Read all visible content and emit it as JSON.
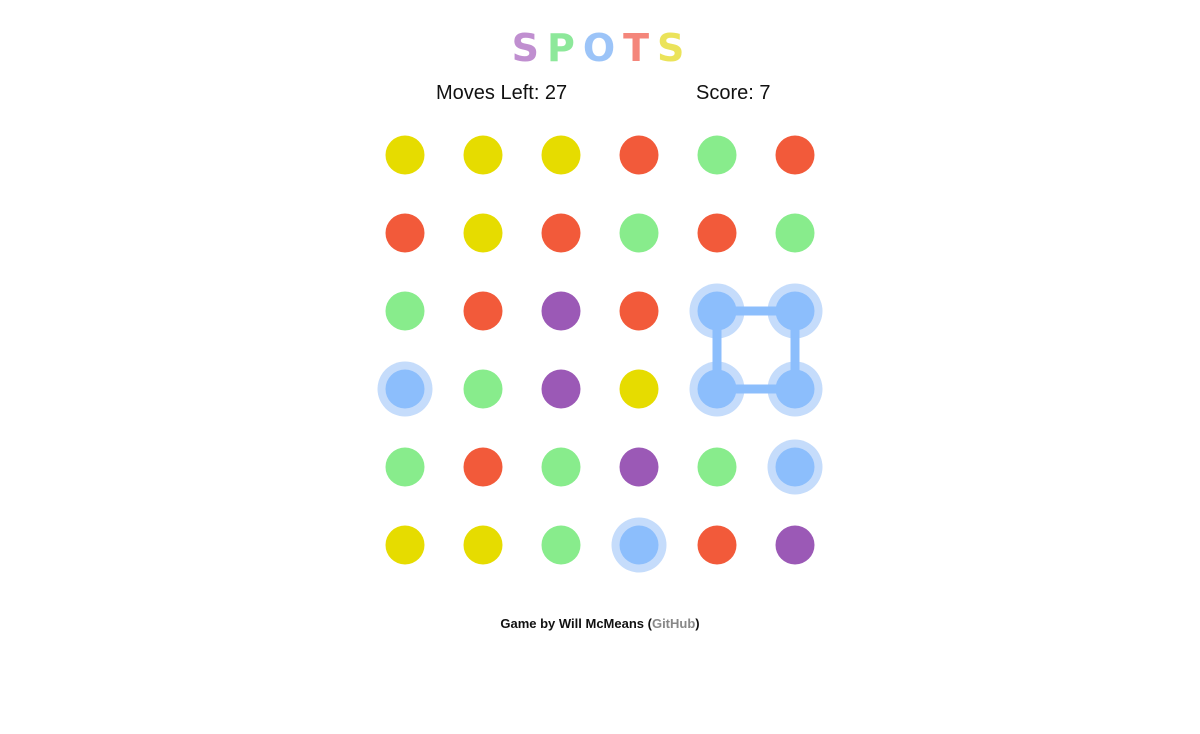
{
  "title": {
    "letters": [
      {
        "char": "S",
        "color": "#c08fd0"
      },
      {
        "char": "P",
        "color": "#8de89a"
      },
      {
        "char": "O",
        "color": "#9cc4f8"
      },
      {
        "char": "T",
        "color": "#f4867b"
      },
      {
        "char": "S",
        "color": "#ebe35a"
      }
    ]
  },
  "stats": {
    "moves": "Moves Left: 27",
    "score": "Score: 7"
  },
  "colors": {
    "yellow": "#e6dc00",
    "red": "#f25a3a",
    "green": "#88ec8c",
    "purple": "#9b59b6",
    "blue": "#8cbefc",
    "selected_halo": "#c5dcfb",
    "connector": "#8cbefc"
  },
  "board": {
    "rows": 6,
    "cols": 6,
    "dots": [
      [
        "yellow",
        "yellow",
        "yellow",
        "red",
        "green",
        "red"
      ],
      [
        "red",
        "yellow",
        "red",
        "green",
        "red",
        "green"
      ],
      [
        "green",
        "red",
        "purple",
        "red",
        "blue",
        "blue"
      ],
      [
        "blue",
        "green",
        "purple",
        "yellow",
        "blue",
        "blue"
      ],
      [
        "green",
        "red",
        "green",
        "purple",
        "green",
        "blue"
      ],
      [
        "yellow",
        "yellow",
        "green",
        "blue",
        "red",
        "purple"
      ]
    ],
    "selected": [
      [
        2,
        4
      ],
      [
        2,
        5
      ],
      [
        3,
        4
      ],
      [
        3,
        5
      ],
      [
        3,
        0
      ],
      [
        4,
        5
      ],
      [
        5,
        3
      ]
    ],
    "connections": [
      [
        [
          2,
          4
        ],
        [
          2,
          5
        ]
      ],
      [
        [
          2,
          5
        ],
        [
          3,
          5
        ]
      ],
      [
        [
          3,
          5
        ],
        [
          3,
          4
        ]
      ],
      [
        [
          3,
          4
        ],
        [
          2,
          4
        ]
      ]
    ]
  },
  "footer": {
    "prefix": "Game by Will McMeans (",
    "link_label": "GitHub",
    "suffix": ")"
  }
}
